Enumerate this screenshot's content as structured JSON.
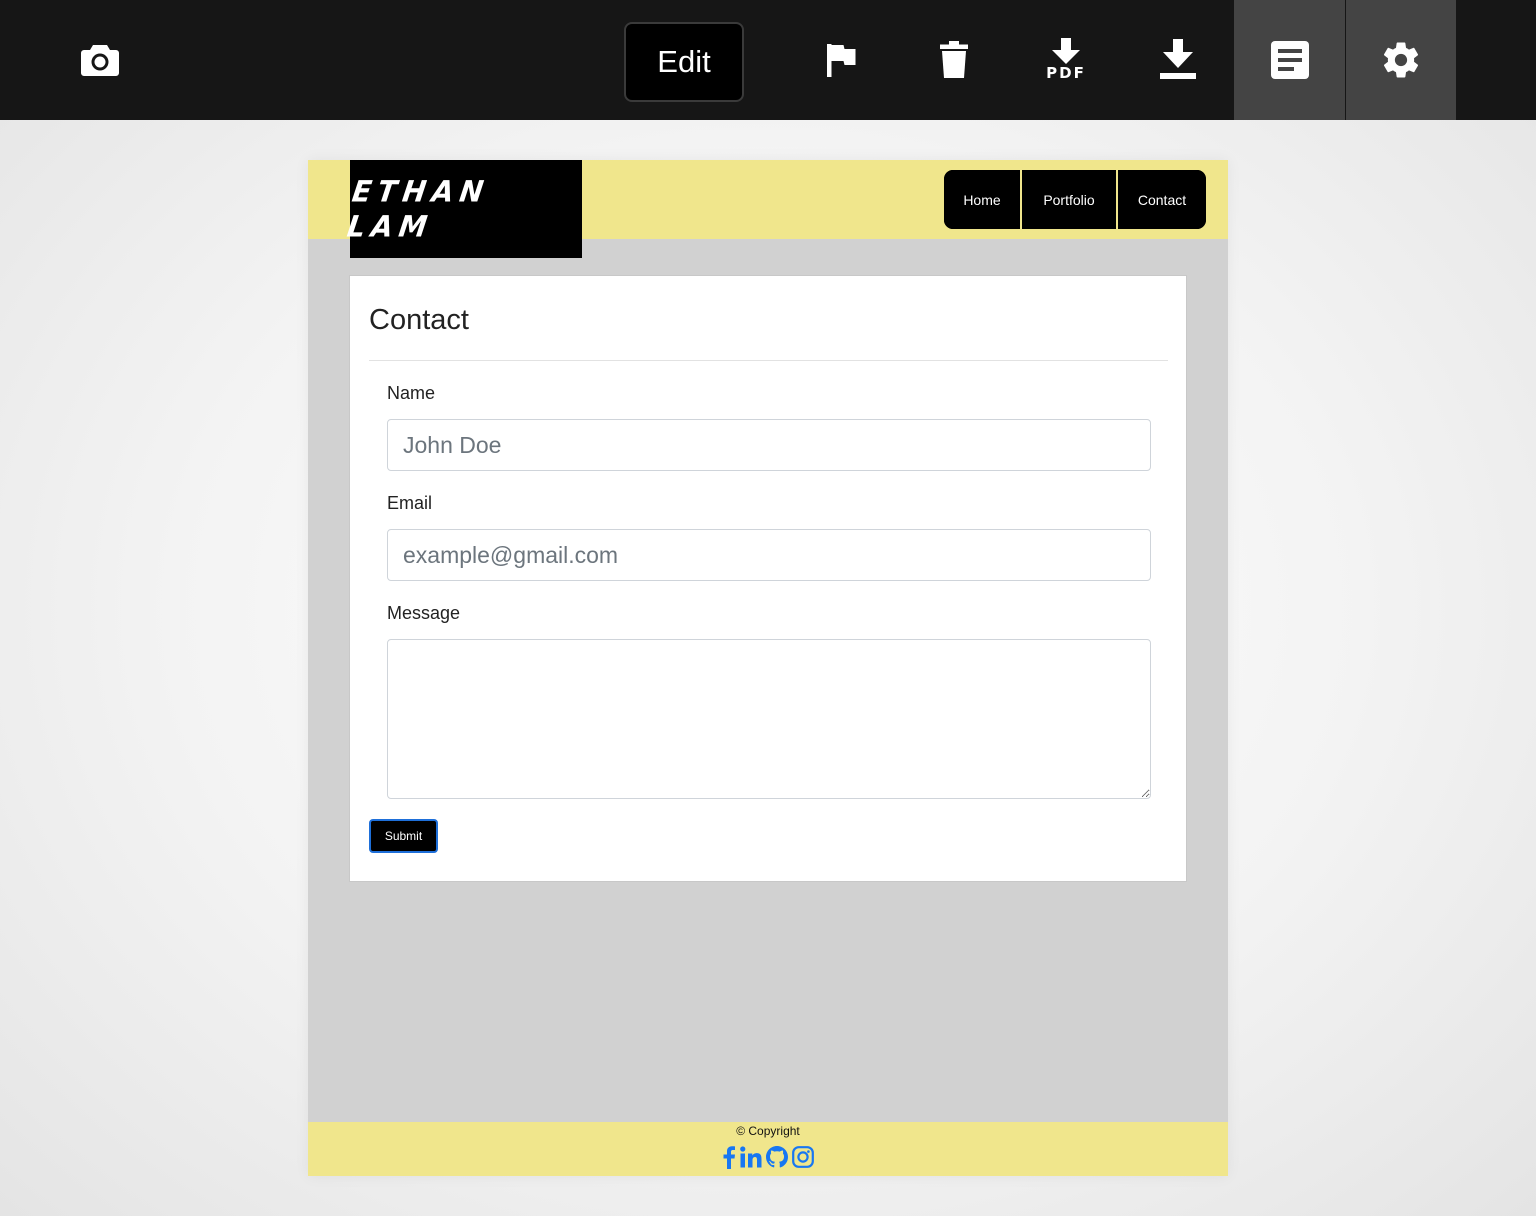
{
  "toolbar": {
    "edit_label": "Edit",
    "pdf_label": "PDF",
    "icons": [
      "camera-icon",
      "flag-icon",
      "trash-icon",
      "pdf-download-icon",
      "download-icon",
      "document-icon",
      "gear-icon"
    ]
  },
  "site": {
    "logo_text": "ETHAN LAM",
    "nav": [
      "Home",
      "Portfolio",
      "Contact"
    ],
    "accent_color": "#f0e68c",
    "background_color": "#d1d1d1"
  },
  "form": {
    "title": "Contact",
    "name_label": "Name",
    "name_placeholder": "John Doe",
    "email_label": "Email",
    "email_placeholder": "example@gmail.com",
    "message_label": "Message",
    "message_value": "",
    "submit_label": "Submit"
  },
  "footer": {
    "copyright": "© Copyright",
    "socials": [
      "facebook-icon",
      "linkedin-icon",
      "github-icon",
      "instagram-icon"
    ],
    "social_color": "#1877f2"
  }
}
